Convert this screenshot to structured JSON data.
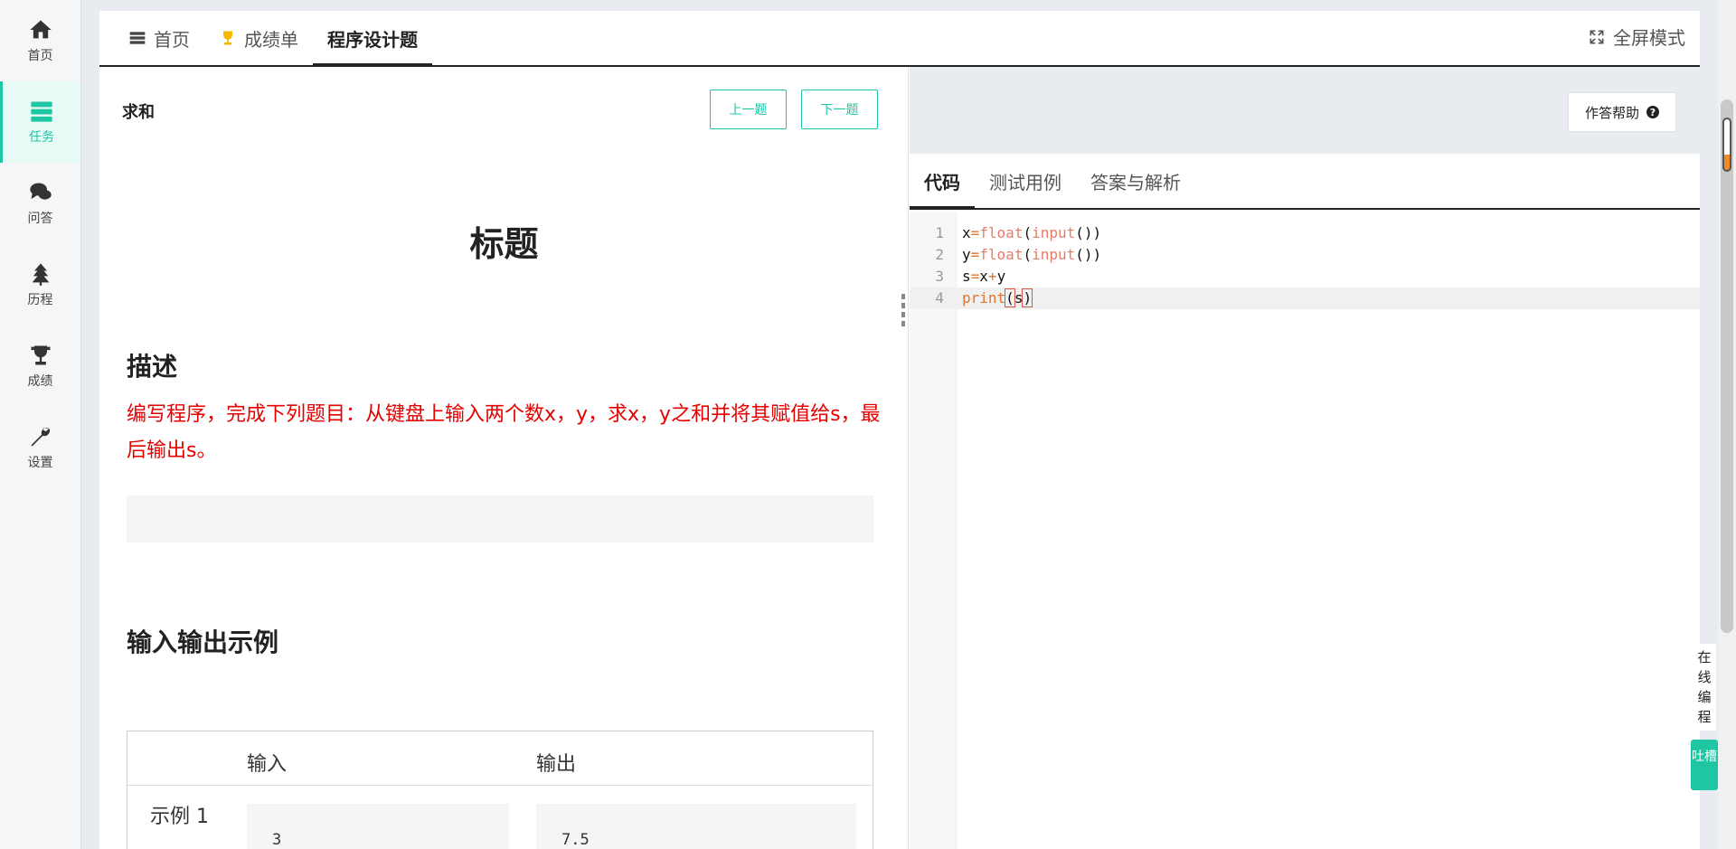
{
  "sidebar": {
    "items": [
      {
        "label": "首页",
        "icon": "home-icon"
      },
      {
        "label": "任务",
        "icon": "tasks-icon"
      },
      {
        "label": "问答",
        "icon": "chat-icon"
      },
      {
        "label": "历程",
        "icon": "tree-icon"
      },
      {
        "label": "成绩",
        "icon": "trophy-icon"
      },
      {
        "label": "设置",
        "icon": "wrench-icon"
      }
    ],
    "active_index": 1,
    "accent": "#1ec6a4"
  },
  "tabs": {
    "home": "首页",
    "scores": "成绩单",
    "programming": "程序设计题",
    "fullscreen": "全屏模式"
  },
  "problem": {
    "name": "求和",
    "prev_label": "上一题",
    "next_label": "下一题",
    "title": "标题",
    "desc_heading": "描述",
    "description": "编写程序，完成下列题目：从键盘上输入两个数x，y，求x，y之和并将其赋值给s，最后输出s。",
    "io_heading": "输入输出示例",
    "io_table": {
      "col_input": "输入",
      "col_output": "输出",
      "rows": [
        {
          "label": "示例 1",
          "input": "3",
          "output": "7.5"
        }
      ]
    }
  },
  "editor": {
    "help_label": "作答帮助",
    "tabs": [
      "代码",
      "测试用例",
      "答案与解析"
    ],
    "lines": [
      {
        "no": "1",
        "text": "x=float(input())"
      },
      {
        "no": "2",
        "text": "y=float(input())"
      },
      {
        "no": "3",
        "text": "s=x+y"
      },
      {
        "no": "4",
        "text": "print(s)"
      }
    ],
    "current_line": 4
  },
  "side": {
    "online_label": "在线编程",
    "tucao_label": "吐槽"
  }
}
